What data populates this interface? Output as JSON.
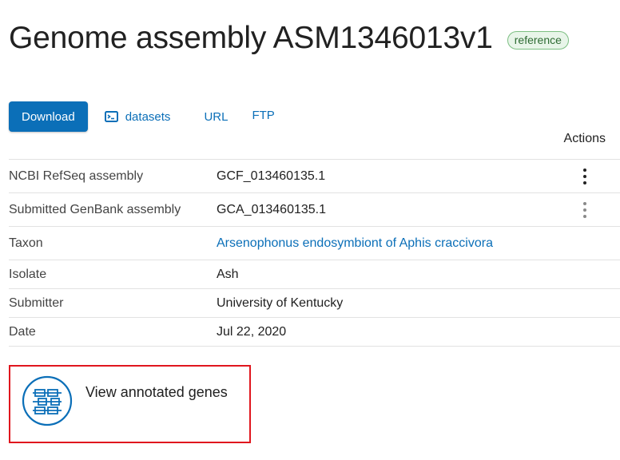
{
  "header": {
    "title": "Genome assembly ASM1346013v1",
    "badge": "reference"
  },
  "toolbar": {
    "download_label": "Download",
    "datasets_label": "datasets",
    "datasets_icon": "terminal-icon",
    "url_label": "URL",
    "ftp_label": "FTP"
  },
  "table": {
    "actions_header": "Actions",
    "rows": [
      {
        "label": "NCBI RefSeq assembly",
        "value": "GCF_013460135.1",
        "has_actions": true
      },
      {
        "label": "Submitted GenBank assembly",
        "value": "GCA_013460135.1",
        "has_actions": true
      },
      {
        "label": "Taxon",
        "value": "Arsenophonus endosymbiont of Aphis craccivora",
        "is_link": true
      },
      {
        "label": "Isolate",
        "value": "Ash"
      },
      {
        "label": "Submitter",
        "value": "University of Kentucky"
      },
      {
        "label": "Date",
        "value": "Jul 22, 2020"
      }
    ]
  },
  "genes_card": {
    "label": "View annotated genes",
    "icon": "gene-diagram-icon"
  },
  "colors": {
    "primary": "#0b6fb8",
    "badge_bg": "#e8f5e9",
    "badge_border": "#7cbf82",
    "highlight": "#e0161e"
  }
}
